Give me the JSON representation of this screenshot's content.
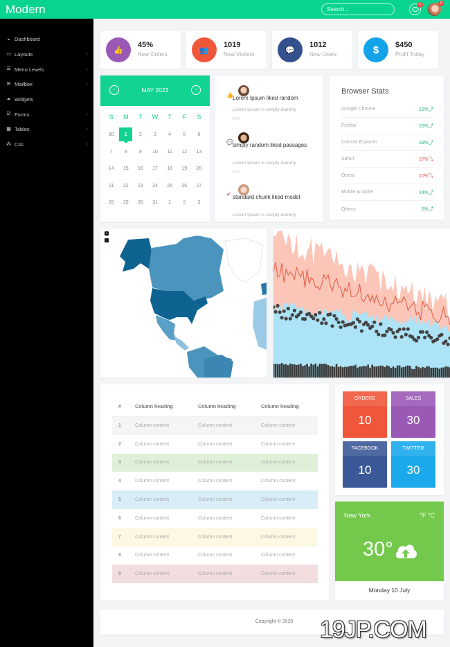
{
  "app": {
    "title": "Modern"
  },
  "topbar": {
    "search_placeholder": "Search...",
    "chat_badge": "0",
    "avatar_badge": "0"
  },
  "sidebar": {
    "items": [
      {
        "label": "Dashboard",
        "icon": "dashboard-icon",
        "glyph": "◒",
        "has_children": false
      },
      {
        "label": "Layouts",
        "icon": "laptop-icon",
        "glyph": "▭",
        "has_children": true
      },
      {
        "label": "Menu Levels",
        "icon": "list-icon",
        "glyph": "☰",
        "has_children": true
      },
      {
        "label": "Mailbox",
        "icon": "envelope-icon",
        "glyph": "✉",
        "has_children": true
      },
      {
        "label": "Widgets",
        "icon": "flask-icon",
        "glyph": "⏶",
        "has_children": false
      },
      {
        "label": "Forms",
        "icon": "checkbox-icon",
        "glyph": "☑",
        "has_children": true
      },
      {
        "label": "Tables",
        "icon": "table-icon",
        "glyph": "▦",
        "has_children": true
      },
      {
        "label": "Css",
        "icon": "sitemap-icon",
        "glyph": "⁂",
        "has_children": true
      }
    ],
    "chevron": "‹"
  },
  "stats": [
    {
      "value": "45%",
      "label": "New Orders",
      "icon": "thumbs-up-icon",
      "glyph": "👍",
      "color": "#9b59b6"
    },
    {
      "value": "1019",
      "label": "New Visitors",
      "icon": "users-icon",
      "glyph": "👥",
      "color": "#f0573a"
    },
    {
      "value": "1012",
      "label": "New Users",
      "icon": "comment-icon",
      "glyph": "💬",
      "color": "#34508f"
    },
    {
      "value": "$450",
      "label": "Profit Today",
      "icon": "dollar-icon",
      "glyph": "$",
      "color": "#13a3e8"
    }
  ],
  "calendar": {
    "title": "MAY 2023",
    "prev": "‹",
    "next": "›",
    "weekdays": [
      "S",
      "M",
      "T",
      "W",
      "T",
      "F",
      "S"
    ],
    "weeks": [
      [
        "30",
        "1",
        "2",
        "3",
        "4",
        "5",
        "6"
      ],
      [
        "7",
        "8",
        "9",
        "10",
        "11",
        "12",
        "13"
      ],
      [
        "14",
        "15",
        "16",
        "17",
        "18",
        "19",
        "20"
      ],
      [
        "21",
        "22",
        "23",
        "24",
        "25",
        "26",
        "27"
      ],
      [
        "28",
        "29",
        "30",
        "31",
        "1",
        "2",
        "3"
      ]
    ],
    "selected": "1"
  },
  "activity": [
    {
      "title": "Lorem Ipsum liked random",
      "desc": "Lorem Ipsum is simply dummy",
      "time": "8:03",
      "icon": "thumbs-up-icon",
      "glyph": "👍",
      "icon_color": "#1e9be8"
    },
    {
      "title": "simply random liked passages",
      "desc": "Lorem Ipsum is simply dummy",
      "time": "8:03",
      "icon": "comment-icon",
      "glyph": "💬",
      "icon_color": "#2a6fa8"
    },
    {
      "title": "standard chunk liked model",
      "desc": "Lorem Ipsum is simply dummy",
      "time": "",
      "icon": "check-icon",
      "glyph": "✔",
      "icon_color": "#e04a4a"
    }
  ],
  "browser_stats": {
    "title": "Browser Stats",
    "rows": [
      {
        "name": "Google Chrome",
        "value": "12%",
        "trend": "up"
      },
      {
        "name": "Firefox",
        "value": "15%",
        "trend": "up"
      },
      {
        "name": "Internet Explorer",
        "value": "18%",
        "trend": "up"
      },
      {
        "name": "Safari",
        "value": "17%",
        "trend": "down"
      },
      {
        "name": "Opera",
        "value": "10%",
        "trend": "down"
      },
      {
        "name": "Mobile & tablet",
        "value": "14%",
        "trend": "up"
      },
      {
        "name": "Others",
        "value": "5%",
        "trend": "up"
      }
    ],
    "up_arrow": "⤴",
    "down_arrow": "⤵"
  },
  "map": {
    "zoom_in": "+",
    "zoom_out": "−"
  },
  "table": {
    "headers": [
      "#",
      "Column heading",
      "Column heading",
      "Column heading"
    ],
    "rows": [
      {
        "num": "1",
        "cells": [
          "Column content",
          "Column content",
          "Column content"
        ],
        "bg": "#f5f5f5"
      },
      {
        "num": "2",
        "cells": [
          "Column content",
          "Column content",
          "Column content"
        ],
        "bg": "#ffffff"
      },
      {
        "num": "3",
        "cells": [
          "Column content",
          "Column content",
          "Column content"
        ],
        "bg": "#dff0d8"
      },
      {
        "num": "4",
        "cells": [
          "Column content",
          "Column content",
          "Column content"
        ],
        "bg": "#ffffff"
      },
      {
        "num": "5",
        "cells": [
          "Column content",
          "Column content",
          "Column content"
        ],
        "bg": "#d9edf7"
      },
      {
        "num": "6",
        "cells": [
          "Column content",
          "Column content",
          "Column content"
        ],
        "bg": "#ffffff"
      },
      {
        "num": "7",
        "cells": [
          "Column content",
          "Column content",
          "Column content"
        ],
        "bg": "#fcf8e3"
      },
      {
        "num": "8",
        "cells": [
          "Column content",
          "Column content",
          "Column content"
        ],
        "bg": "#ffffff"
      },
      {
        "num": "9",
        "cells": [
          "Column content",
          "Column content",
          "Column content"
        ],
        "bg": "#f2dede"
      }
    ]
  },
  "tiles": [
    {
      "label": "ORDERS",
      "value": "10",
      "color": "#f0573a"
    },
    {
      "label": "SALES",
      "value": "30",
      "color": "#9b59b6"
    },
    {
      "label": "FACEBOOK",
      "value": "10",
      "color": "#3b5998"
    },
    {
      "label": "TWITTER",
      "value": "30",
      "color": "#1aa9ec"
    }
  ],
  "weather": {
    "city": "New York",
    "units": "°F °C",
    "temp": "30°",
    "icon": "cloud-upload-icon",
    "date": "Monday 10 July"
  },
  "footer": {
    "copyright": "Copyright © 2020"
  },
  "watermark": "19JP.COM",
  "colors": {
    "brand": "#09d48f",
    "accent": "#13d392"
  }
}
